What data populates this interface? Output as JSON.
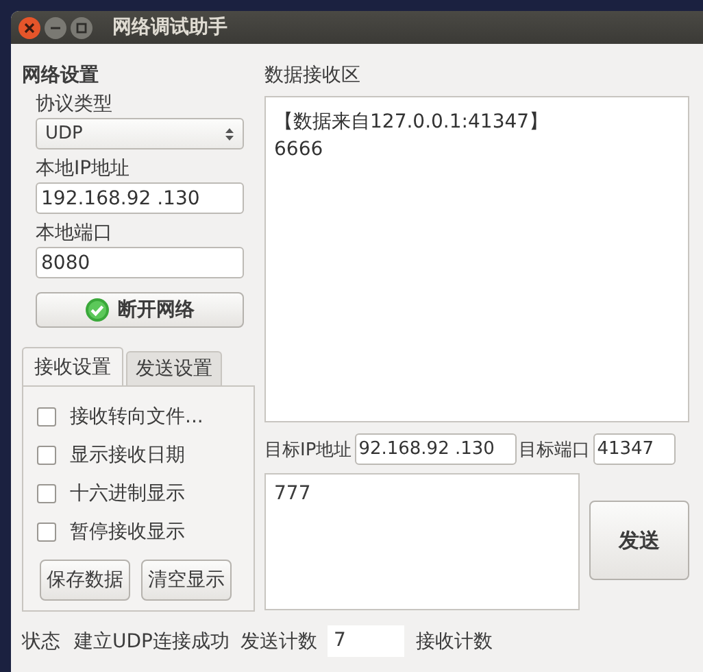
{
  "window": {
    "title": "网络调试助手"
  },
  "network_settings": {
    "heading": "网络设置",
    "protocol_label": "协议类型",
    "protocol": "UDP",
    "local_ip_label": "本地IP地址",
    "local_ip": "192.168.92 .130",
    "local_port_label": "本地端口",
    "local_port": "8080",
    "connect_button": "断开网络"
  },
  "tabs": [
    {
      "label": "接收设置",
      "selected": true
    },
    {
      "label": "发送设置",
      "selected": false
    }
  ],
  "options": [
    {
      "label": "接收转向文件...",
      "checked": false
    },
    {
      "label": "显示接收日期",
      "checked": false
    },
    {
      "label": "十六进制显示",
      "checked": false
    },
    {
      "label": "暂停接收显示",
      "checked": false
    }
  ],
  "panel_buttons": [
    "保存数据",
    "清空显示"
  ],
  "receive_area": {
    "heading": "数据接收区",
    "lines": [
      "【数据来自127.0.0.1:41347】",
      "6666"
    ]
  },
  "target": {
    "ip_label": "目标IP地址",
    "ip": "92.168.92 .130",
    "port_label": "目标端口",
    "port": "41347"
  },
  "send_area": {
    "text": "777",
    "send_button": "发送"
  },
  "status_bar": {
    "label": "状态",
    "message": "建立UDP连接成功",
    "send_count_label": "发送计数",
    "send_count": "7",
    "receive_count_label": "接收计数"
  }
}
